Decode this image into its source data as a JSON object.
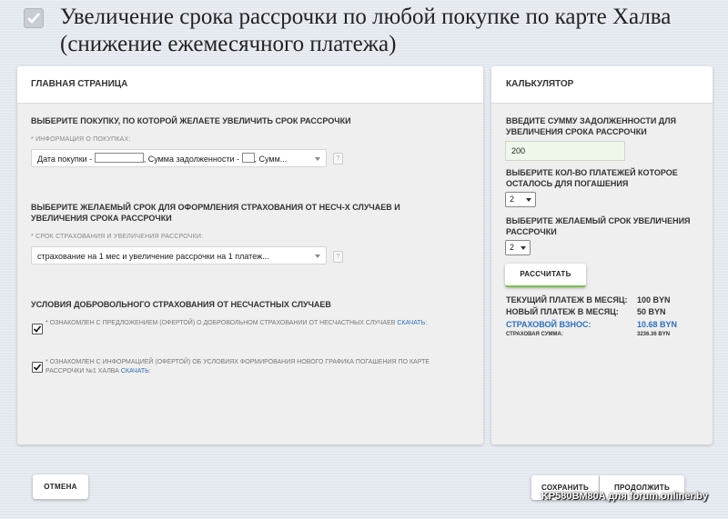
{
  "header": {
    "title": "Увеличение срока рассрочки по любой покупке по карте Халва (снижение ежемесячного платежа)"
  },
  "main_panel": {
    "heading": "ГЛАВНАЯ СТРАНИЦА",
    "purchase_section": {
      "title": "ВЫБЕРИТЕ ПОКУПКУ, ПО КОТОРОЙ ЖЕЛАЕТЕ УВЕЛИЧИТЬ СРОК РАССРОЧКИ",
      "field_label": "* ИНФОРМАЦИЯ О ПОКУПКАХ:",
      "select_part1": "Дата покупки - ",
      "select_part2": ", Сумма задолженности - ",
      "select_part3": ", Сумм..."
    },
    "term_section": {
      "title": "ВЫБЕРИТЕ ЖЕЛАЕМЫЙ СРОК ДЛЯ ОФОРМЛЕНИЯ СТРАХОВАНИЯ ОТ НЕСЧ-Х СЛУЧАЕВ И УВЕЛИЧЕНИЯ СРОКА РАССРОЧКИ",
      "field_label": "* СРОК СТРАХОВАНИЯ И УВЕЛИЧЕНИЯ РАССРОЧКИ:",
      "select_value": "страхование на 1 мес и увеличение рассрочки на 1 платеж..."
    },
    "conditions_section": {
      "title": "УСЛОВИЯ ДОБРОВОЛЬНОГО СТРАХОВАНИЯ ОТ НЕСЧАСТНЫХ СЛУЧАЕВ",
      "checkbox1_text": "* ОЗНАКОМЛЕН С ПРЕДЛОЖЕНИЕМ (ОФЕРТОЙ) О ДОБРОВОЛЬНОМ СТРАХОВАНИИ ОТ НЕСЧАСТНЫХ СЛУЧАЕВ",
      "checkbox1_link": "СКАЧАТЬ",
      "checkbox2_text": "* ОЗНАКОМЛЕН С ИНФОРМАЦИЕЙ (ОФЕРТОЙ) ОБ УСЛОВИЯХ ФОРМИРОВАНИЯ НОВОГО ГРАФИКА ПОГАШЕНИЯ ПО КАРТЕ РАССРОЧКИ №1 ХАЛВА",
      "checkbox2_link": "СКАЧАТЬ"
    }
  },
  "calculator": {
    "heading": "КАЛЬКУЛЯТОР",
    "debt_label": "ВВЕДИТЕ СУММУ ЗАДОЛЖЕННОСТИ ДЛЯ УВЕЛИЧЕНИЯ СРОКА РАССРОЧКИ",
    "debt_value": "200",
    "payments_label": "ВЫБЕРИТЕ КОЛ-ВО ПЛАТЕЖЕЙ КОТОРОЕ ОСТАЛОСЬ ДЛЯ ПОГАШЕНИЯ",
    "payments_value": "2",
    "term_label": "ВЫБЕРИТЕ ЖЕЛАЕМЫЙ СРОК УВЕЛИЧЕНИЯ РАССРОЧКИ",
    "term_value": "2",
    "calc_button": "РАССЧИТАТЬ",
    "results": {
      "current_payment_label": "ТЕКУЩИЙ ПЛАТЕЖ В МЕСЯЦ:",
      "current_payment_value": "100 BYN",
      "new_payment_label": "НОВЫЙ ПЛАТЕЖ В МЕСЯЦ:",
      "new_payment_value": "50 BYN",
      "insurance_fee_label": "СТРАХОВОЙ ВЗНОС:",
      "insurance_fee_value": "10.68 BYN",
      "insurance_sum_label": "СТРАХОВАЯ СУММА:",
      "insurance_sum_value": "3236.36 BYN"
    }
  },
  "footer": {
    "cancel_button": "ОТМЕНА",
    "save_button": "СОХРАНИТЬ",
    "continue_button": "ПРОДОЛЖИТЬ"
  },
  "watermark": "KP580BM80A для forum.onliner.by",
  "colors": {
    "accent_green": "#7cc04b",
    "link_blue": "#2c6fbf"
  }
}
